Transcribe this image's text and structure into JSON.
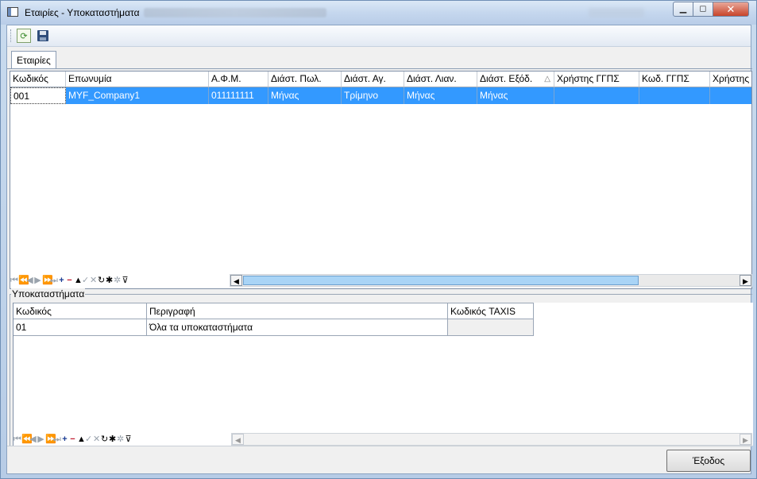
{
  "window": {
    "title": "Εταιρίες - Υποκαταστήματα",
    "controls": {
      "minimize": "▭",
      "maximize": "□",
      "close": "✕"
    }
  },
  "toolbar": {
    "refresh_icon": "refresh-icon",
    "save_icon": "save-icon"
  },
  "tabs": [
    {
      "label": "Εταιρίες"
    }
  ],
  "companies_grid": {
    "columns": [
      "Κωδικός",
      "Επωνυμία",
      "Α.Φ.Μ.",
      "Διάστ. Πωλ.",
      "Διάστ. Αγ.",
      "Διάστ. Λιαν.",
      "Διάστ. Εξόδ.",
      "Χρήστης ΓΓΠΣ",
      "Κωδ. ΓΓΠΣ",
      "Χρήστης"
    ],
    "sort_indicator": "△",
    "rows": [
      [
        "001",
        "MYF_Company1",
        "011111111",
        "Μήνας",
        "Τρίμηνο",
        "Μήνας",
        "Μήνας",
        "",
        "",
        ""
      ]
    ]
  },
  "navigator": {
    "first": "⏮",
    "prev_page": "⏪",
    "prev": "◀",
    "next": "▶",
    "next_page": "⏩",
    "last": "⏭",
    "add": "+",
    "delete": "−",
    "up": "▲",
    "post": "✓",
    "cancel": "✕",
    "refresh": "↻",
    "apply": "✱",
    "new": "✲",
    "filter": "⊽"
  },
  "branches": {
    "legend": "Υποκαταστήματα",
    "columns": [
      "Κωδικός",
      "Περιγραφή",
      "Κωδικός TAXIS"
    ],
    "rows": [
      [
        "01",
        "Όλα τα υποκαταστήματα",
        ""
      ]
    ]
  },
  "footer": {
    "exit_label": "Έξοδος"
  }
}
